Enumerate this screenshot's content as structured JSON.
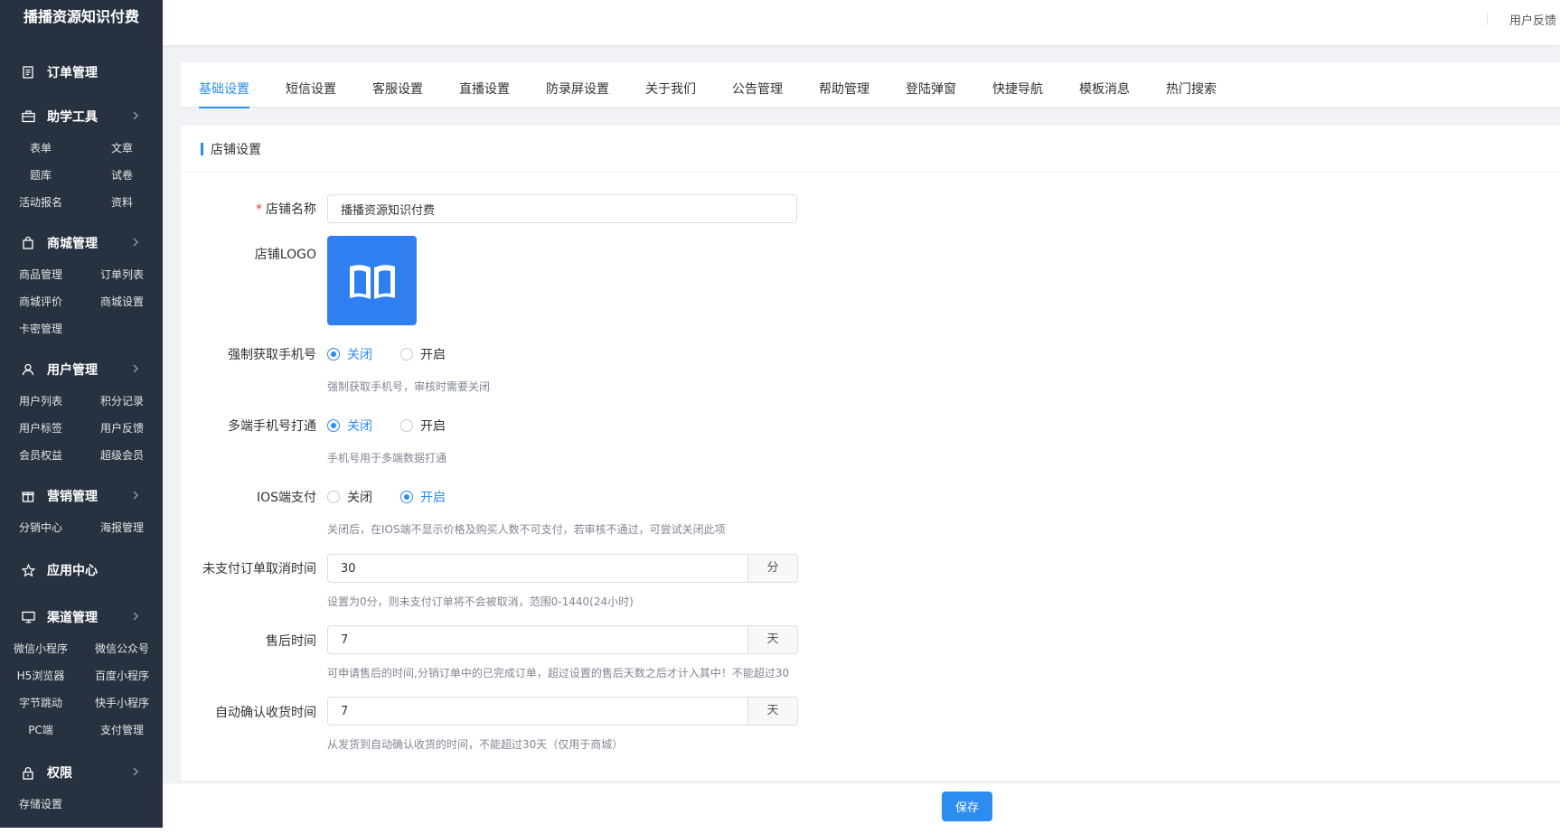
{
  "sidebar": {
    "brand": "播播资源知识付费",
    "groups": [
      {
        "title": "订单管理",
        "icon": "order-doc-icon",
        "arrow": false,
        "items": []
      },
      {
        "title": "助学工具",
        "icon": "briefcase-icon",
        "arrow": true,
        "items": [
          "表单",
          "文章",
          "题库",
          "试卷",
          "活动报名",
          "资料"
        ]
      },
      {
        "title": "商城管理",
        "icon": "shopping-bag-icon",
        "arrow": true,
        "items": [
          "商品管理",
          "订单列表",
          "商城评价",
          "商城设置",
          "卡密管理"
        ]
      },
      {
        "title": "用户管理",
        "icon": "user-icon",
        "arrow": true,
        "items": [
          "用户列表",
          "积分记录",
          "用户标签",
          "用户反馈",
          "会员权益",
          "超级会员"
        ]
      },
      {
        "title": "营销管理",
        "icon": "gift-icon",
        "arrow": true,
        "items": [
          "分销中心",
          "海报管理"
        ]
      },
      {
        "title": "应用中心",
        "icon": "star-icon",
        "arrow": false,
        "items": []
      },
      {
        "title": "渠道管理",
        "icon": "monitor-icon",
        "arrow": true,
        "items": [
          "微信小程序",
          "微信公众号",
          "H5浏览器",
          "百度小程序",
          "字节跳动",
          "快手小程序",
          "PC端",
          "支付管理"
        ]
      },
      {
        "title": "权限",
        "icon": "lock-icon",
        "arrow": true,
        "items": [
          "存储设置"
        ]
      }
    ]
  },
  "header": {
    "feedback": "用户反馈"
  },
  "tabs": [
    "基础设置",
    "短信设置",
    "客服设置",
    "直播设置",
    "防录屏设置",
    "关于我们",
    "公告管理",
    "帮助管理",
    "登陆弹窗",
    "快捷导航",
    "模板消息",
    "热门搜索"
  ],
  "active_tab": 0,
  "section_title": "店铺设置",
  "form": {
    "shop_name": {
      "label": "店铺名称",
      "required_mark": "*",
      "value": "播播资源知识付费"
    },
    "shop_logo": {
      "label": "店铺LOGO",
      "icon": "open-book-icon"
    },
    "force_phone": {
      "label": "强制获取手机号",
      "off": "关闭",
      "on": "开启",
      "selected": "off",
      "hint": "强制获取手机号，审核时需要关闭"
    },
    "multi_phone": {
      "label": "多端手机号打通",
      "off": "关闭",
      "on": "开启",
      "selected": "off",
      "hint": "手机号用于多端数据打通"
    },
    "ios_pay": {
      "label": "IOS端支付",
      "off": "关闭",
      "on": "开启",
      "selected": "on",
      "hint": "关闭后，在IOS端不显示价格及购买人数不可支付，若审核不通过，可尝试关闭此项"
    },
    "unpaid_cancel": {
      "label": "未支付订单取消时间",
      "value": "30",
      "unit": "分",
      "hint": "设置为0分，则未支付订单将不会被取消，范围0-1440(24小时)"
    },
    "after_sale": {
      "label": "售后时间",
      "value": "7",
      "unit": "天",
      "hint": "可申请售后的时间,分销订单中的已完成订单，超过设置的售后天数之后才计入其中！不能超过30"
    },
    "auto_confirm": {
      "label": "自动确认收货时间",
      "value": "7",
      "unit": "天",
      "hint": "从发货到自动确认收货的时间，不能超过30天（仅用于商城）"
    }
  },
  "footer": {
    "save_label": "保存"
  },
  "colors": {
    "sidebar_bg": "#27313f",
    "accent": "#2d8cf0",
    "logo_bg": "#2f7ff0"
  }
}
